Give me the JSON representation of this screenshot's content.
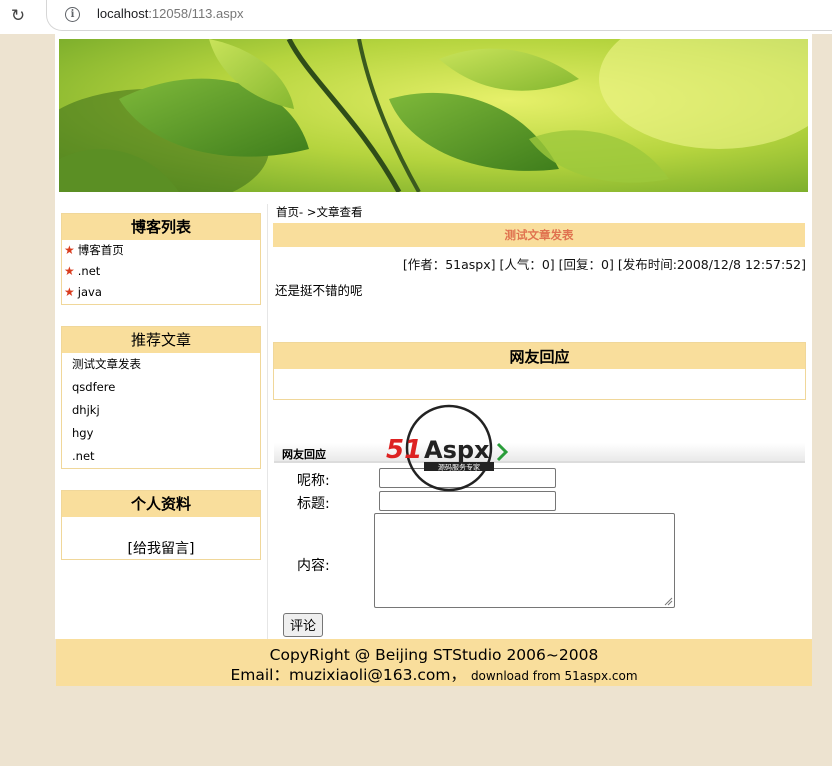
{
  "browser": {
    "url_host": "localhost",
    "url_rest": ":12058/113.aspx"
  },
  "sidebar": {
    "blog_list": {
      "title": "博客列表",
      "items": [
        "博客首页",
        ".net",
        "java"
      ]
    },
    "recommended": {
      "title": "推荐文章",
      "items": [
        "测试文章发表",
        "qsdfere",
        "dhjkj",
        "hgy",
        ".net"
      ]
    },
    "profile": {
      "title": "个人资料",
      "message_link": "[给我留言]"
    }
  },
  "article": {
    "breadcrumb": "首页- >文章查看",
    "title": "测试文章发表",
    "meta": "[作者：51aspx] [人气：0] [回复：0] [发布时间:2008/12/8 12:57:52]",
    "body": "还是挺不错的呢"
  },
  "replies": {
    "title": "网友回应"
  },
  "comment_form": {
    "header": "网友回应",
    "nickname_label": "呢称:",
    "nickname_value": "",
    "subject_label": "标题:",
    "subject_value": "",
    "content_label": "内容:",
    "content_value": "",
    "submit_label": "评论"
  },
  "watermark": {
    "brand_num": "51",
    "brand_text": "Aspx",
    "slogan": "源码服务专家"
  },
  "footer": {
    "line1": "CopyRight  @   Beijing STStudio 2006~2008",
    "line2_main": "Email：muzixiaoli@163.com，",
    "line2_small": "download from 51aspx.com"
  },
  "colors": {
    "page_bg": "#EDE3D0",
    "header_bg": "#F9DE9C",
    "border": "#F0D79A",
    "title_accent": "#E0734F",
    "star": "#D93C1E"
  }
}
